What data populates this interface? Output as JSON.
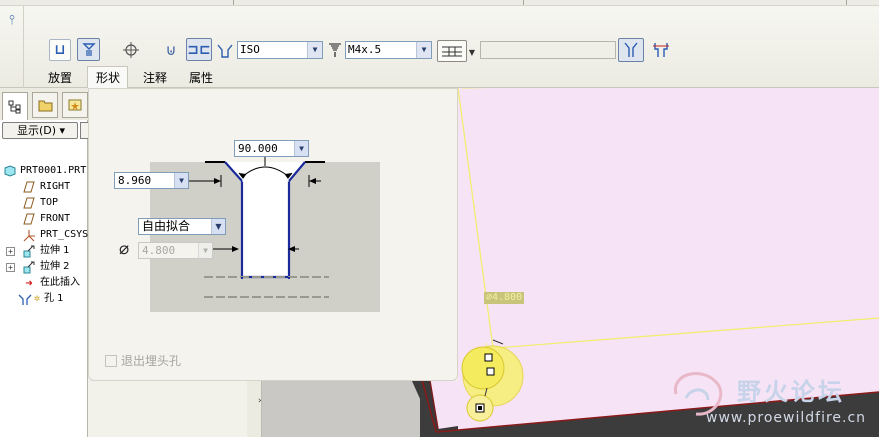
{
  "toolbar": {
    "tabs": [
      {
        "label": "放置",
        "active": false
      },
      {
        "label": "形状",
        "active": true
      },
      {
        "label": "注释",
        "active": false
      },
      {
        "label": "属性",
        "active": false
      }
    ],
    "standard": {
      "value": "ISO"
    },
    "screw_size": {
      "value": "M4x.5"
    },
    "depth_field": {
      "value": ""
    }
  },
  "tree": {
    "show_button": "显示(D) ▾",
    "items": [
      {
        "label": "PRT0001.PRT",
        "icon": "part-icon"
      },
      {
        "label": "RIGHT",
        "icon": "datum-plane-icon"
      },
      {
        "label": "TOP",
        "icon": "datum-plane-icon"
      },
      {
        "label": "FRONT",
        "icon": "datum-plane-icon"
      },
      {
        "label": "PRT_CSYS",
        "icon": "csys-icon"
      },
      {
        "label": "拉伸 1",
        "icon": "extrude-icon"
      },
      {
        "label": "拉伸 2",
        "icon": "extrude-icon"
      },
      {
        "label": "在此插入",
        "icon": "insert-here-icon"
      },
      {
        "label": "孔 1",
        "icon": "hole-icon"
      }
    ]
  },
  "shape": {
    "angle": "90.000",
    "countersink_diameter": "8.960",
    "fit": "自由拟合",
    "diameter": "4.800",
    "exit_countersink_label": "退出埋头孔",
    "exit_countersink_checked": false
  },
  "viewport": {
    "dimension_tag": "⌀4.800",
    "watermark_title": "野火论坛",
    "watermark_url": "www.proewildfire.cn"
  }
}
